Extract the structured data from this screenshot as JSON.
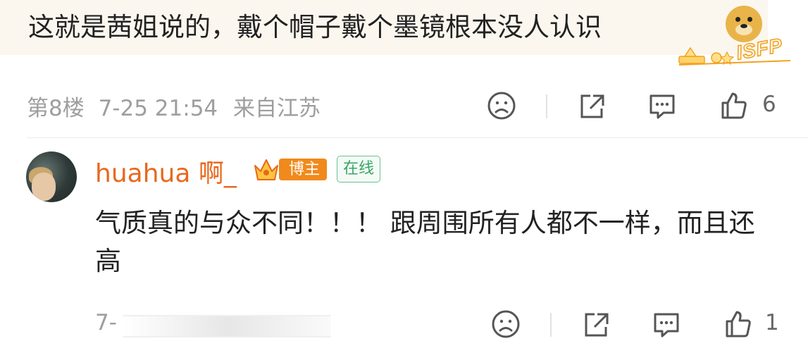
{
  "top_comment": {
    "text": "这就是茜姐说的，戴个帽子戴个墨镜根本没人认识",
    "sticker_icon": "doge-icon",
    "badge_text": "ISFP"
  },
  "comment_meta": {
    "floor": "第8楼",
    "datetime": "7-25 21:54",
    "location": "来自江苏",
    "like_count": "6"
  },
  "reply": {
    "username": "huahua 啊_",
    "role_tag": "博主",
    "status_tag": "在线",
    "text": "气质真的与众不同！！！ 跟周围所有人都不一样，而且还高",
    "date_prefix": "7-",
    "like_count": "1"
  },
  "colors": {
    "username": "#e8681d",
    "role_tag_bg": "#f08a1c",
    "online_green": "#3aa566",
    "meta_gray": "#9e9e9e"
  }
}
